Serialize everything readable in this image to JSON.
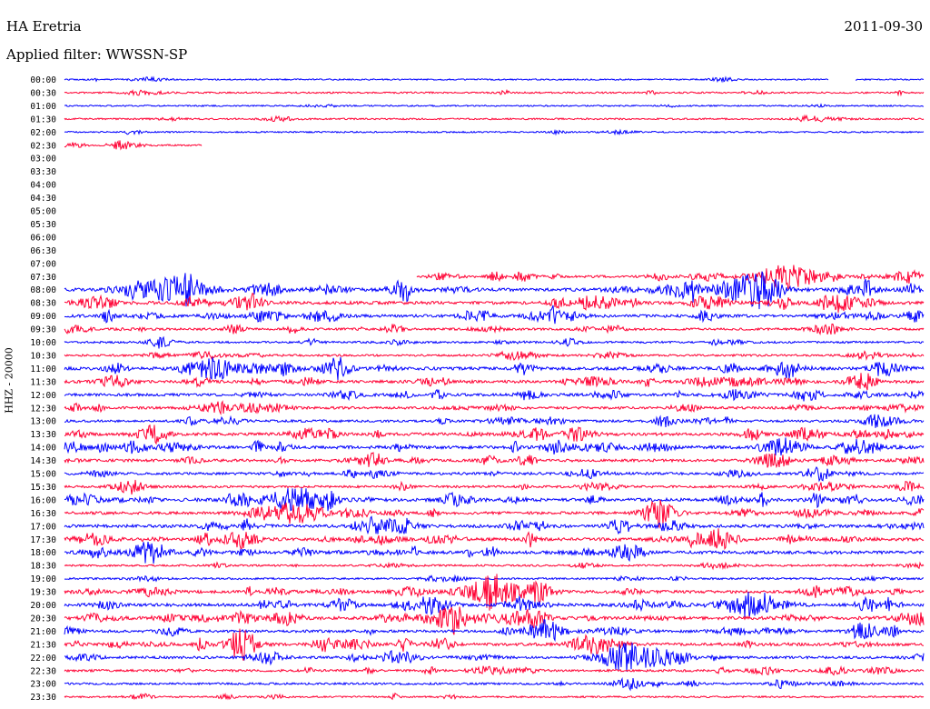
{
  "header": {
    "station": "HA Eretria",
    "date": "2011-09-30",
    "filter": "Applied filter: WWSSN-SP",
    "ylabel": "HHZ - 20000"
  },
  "colors": {
    "blue": "#0000ff",
    "red": "#ff0033"
  },
  "chart_data": {
    "type": "line",
    "title": "HA Eretria",
    "subtitle": "Applied filter: WWSSN-SP",
    "ylabel": "HHZ - 20000",
    "date": "2011-09-30",
    "rows": [
      {
        "label": "00:00",
        "color": "blue",
        "start": 0.0,
        "end": 1.0,
        "level": 0.5,
        "gap": [
          0.89,
          0.92
        ]
      },
      {
        "label": "00:30",
        "color": "red",
        "start": 0.0,
        "end": 1.0,
        "level": 0.8
      },
      {
        "label": "01:00",
        "color": "blue",
        "start": 0.0,
        "end": 1.0,
        "level": 0.5
      },
      {
        "label": "01:30",
        "color": "red",
        "start": 0.0,
        "end": 1.0,
        "level": 0.8
      },
      {
        "label": "02:00",
        "color": "blue",
        "start": 0.0,
        "end": 1.0,
        "level": 0.6
      },
      {
        "label": "02:30",
        "color": "red",
        "start": 0.0,
        "end": 0.16,
        "level": 0.8
      },
      {
        "label": "03:00",
        "color": "blue",
        "start": 0,
        "end": 0,
        "level": 0
      },
      {
        "label": "03:30",
        "color": "red",
        "start": 0,
        "end": 0,
        "level": 0
      },
      {
        "label": "04:00",
        "color": "blue",
        "start": 0,
        "end": 0,
        "level": 0
      },
      {
        "label": "04:30",
        "color": "red",
        "start": 0,
        "end": 0,
        "level": 0
      },
      {
        "label": "05:00",
        "color": "blue",
        "start": 0,
        "end": 0,
        "level": 0
      },
      {
        "label": "05:30",
        "color": "red",
        "start": 0,
        "end": 0,
        "level": 0
      },
      {
        "label": "06:00",
        "color": "blue",
        "start": 0,
        "end": 0,
        "level": 0
      },
      {
        "label": "06:30",
        "color": "red",
        "start": 0,
        "end": 0,
        "level": 0
      },
      {
        "label": "07:00",
        "color": "blue",
        "start": 0,
        "end": 0,
        "level": 0
      },
      {
        "label": "07:30",
        "color": "red",
        "start": 0.41,
        "end": 1.0,
        "level": 2.0
      },
      {
        "label": "08:00",
        "color": "blue",
        "start": 0.0,
        "end": 1.0,
        "level": 3.0
      },
      {
        "label": "08:30",
        "color": "red",
        "start": 0.0,
        "end": 1.0,
        "level": 3.0
      },
      {
        "label": "09:00",
        "color": "blue",
        "start": 0.0,
        "end": 1.0,
        "level": 2.6
      },
      {
        "label": "09:30",
        "color": "red",
        "start": 0.0,
        "end": 1.0,
        "level": 1.8
      },
      {
        "label": "10:00",
        "color": "blue",
        "start": 0.0,
        "end": 1.0,
        "level": 1.4
      },
      {
        "label": "10:30",
        "color": "red",
        "start": 0.0,
        "end": 1.0,
        "level": 1.4
      },
      {
        "label": "11:00",
        "color": "blue",
        "start": 0.0,
        "end": 1.0,
        "level": 3.0
      },
      {
        "label": "11:30",
        "color": "red",
        "start": 0.0,
        "end": 1.0,
        "level": 2.6
      },
      {
        "label": "12:00",
        "color": "blue",
        "start": 0.0,
        "end": 1.0,
        "level": 2.4
      },
      {
        "label": "12:30",
        "color": "red",
        "start": 0.0,
        "end": 1.0,
        "level": 2.2
      },
      {
        "label": "13:00",
        "color": "blue",
        "start": 0.0,
        "end": 1.0,
        "level": 2.0
      },
      {
        "label": "13:30",
        "color": "red",
        "start": 0.0,
        "end": 1.0,
        "level": 2.8
      },
      {
        "label": "14:00",
        "color": "blue",
        "start": 0.0,
        "end": 1.0,
        "level": 3.0
      },
      {
        "label": "14:30",
        "color": "red",
        "start": 0.0,
        "end": 1.0,
        "level": 2.4
      },
      {
        "label": "15:00",
        "color": "blue",
        "start": 0.0,
        "end": 1.0,
        "level": 2.2
      },
      {
        "label": "15:30",
        "color": "red",
        "start": 0.0,
        "end": 1.0,
        "level": 1.8
      },
      {
        "label": "16:00",
        "color": "blue",
        "start": 0.0,
        "end": 1.0,
        "level": 3.2
      },
      {
        "label": "16:30",
        "color": "red",
        "start": 0.0,
        "end": 1.0,
        "level": 2.6
      },
      {
        "label": "17:00",
        "color": "blue",
        "start": 0.0,
        "end": 1.0,
        "level": 3.0
      },
      {
        "label": "17:30",
        "color": "red",
        "start": 0.0,
        "end": 1.0,
        "level": 3.0
      },
      {
        "label": "18:00",
        "color": "blue",
        "start": 0.0,
        "end": 1.0,
        "level": 3.0
      },
      {
        "label": "18:30",
        "color": "red",
        "start": 0.0,
        "end": 1.0,
        "level": 1.2
      },
      {
        "label": "19:00",
        "color": "blue",
        "start": 0.0,
        "end": 1.0,
        "level": 1.2
      },
      {
        "label": "19:30",
        "color": "red",
        "start": 0.0,
        "end": 1.0,
        "level": 2.8
      },
      {
        "label": "20:00",
        "color": "blue",
        "start": 0.0,
        "end": 1.0,
        "level": 3.0
      },
      {
        "label": "20:30",
        "color": "red",
        "start": 0.0,
        "end": 1.0,
        "level": 3.2
      },
      {
        "label": "21:00",
        "color": "blue",
        "start": 0.0,
        "end": 1.0,
        "level": 2.4
      },
      {
        "label": "21:30",
        "color": "red",
        "start": 0.0,
        "end": 1.0,
        "level": 2.8
      },
      {
        "label": "22:00",
        "color": "blue",
        "start": 0.0,
        "end": 1.0,
        "level": 2.2
      },
      {
        "label": "22:30",
        "color": "red",
        "start": 0.0,
        "end": 1.0,
        "level": 1.8
      },
      {
        "label": "23:00",
        "color": "blue",
        "start": 0.0,
        "end": 1.0,
        "level": 1.4
      },
      {
        "label": "23:30",
        "color": "red",
        "start": 0.0,
        "end": 1.0,
        "level": 1.0
      }
    ],
    "events": [
      {
        "row": "08:00",
        "at": 0.13,
        "strength": 1.0
      },
      {
        "row": "08:00",
        "at": 0.79,
        "strength": 0.9
      },
      {
        "row": "07:30",
        "at": 0.84,
        "strength": 1.0
      },
      {
        "row": "16:00",
        "at": 0.27,
        "strength": 0.9
      },
      {
        "row": "16:30",
        "at": 0.27,
        "strength": 0.8
      },
      {
        "row": "20:00",
        "at": 0.8,
        "strength": 0.9
      },
      {
        "row": "20:30",
        "at": 0.45,
        "strength": 0.8
      },
      {
        "row": "19:30",
        "at": 0.5,
        "strength": 1.0
      },
      {
        "row": "22:00",
        "at": 0.66,
        "strength": 1.0
      }
    ]
  }
}
